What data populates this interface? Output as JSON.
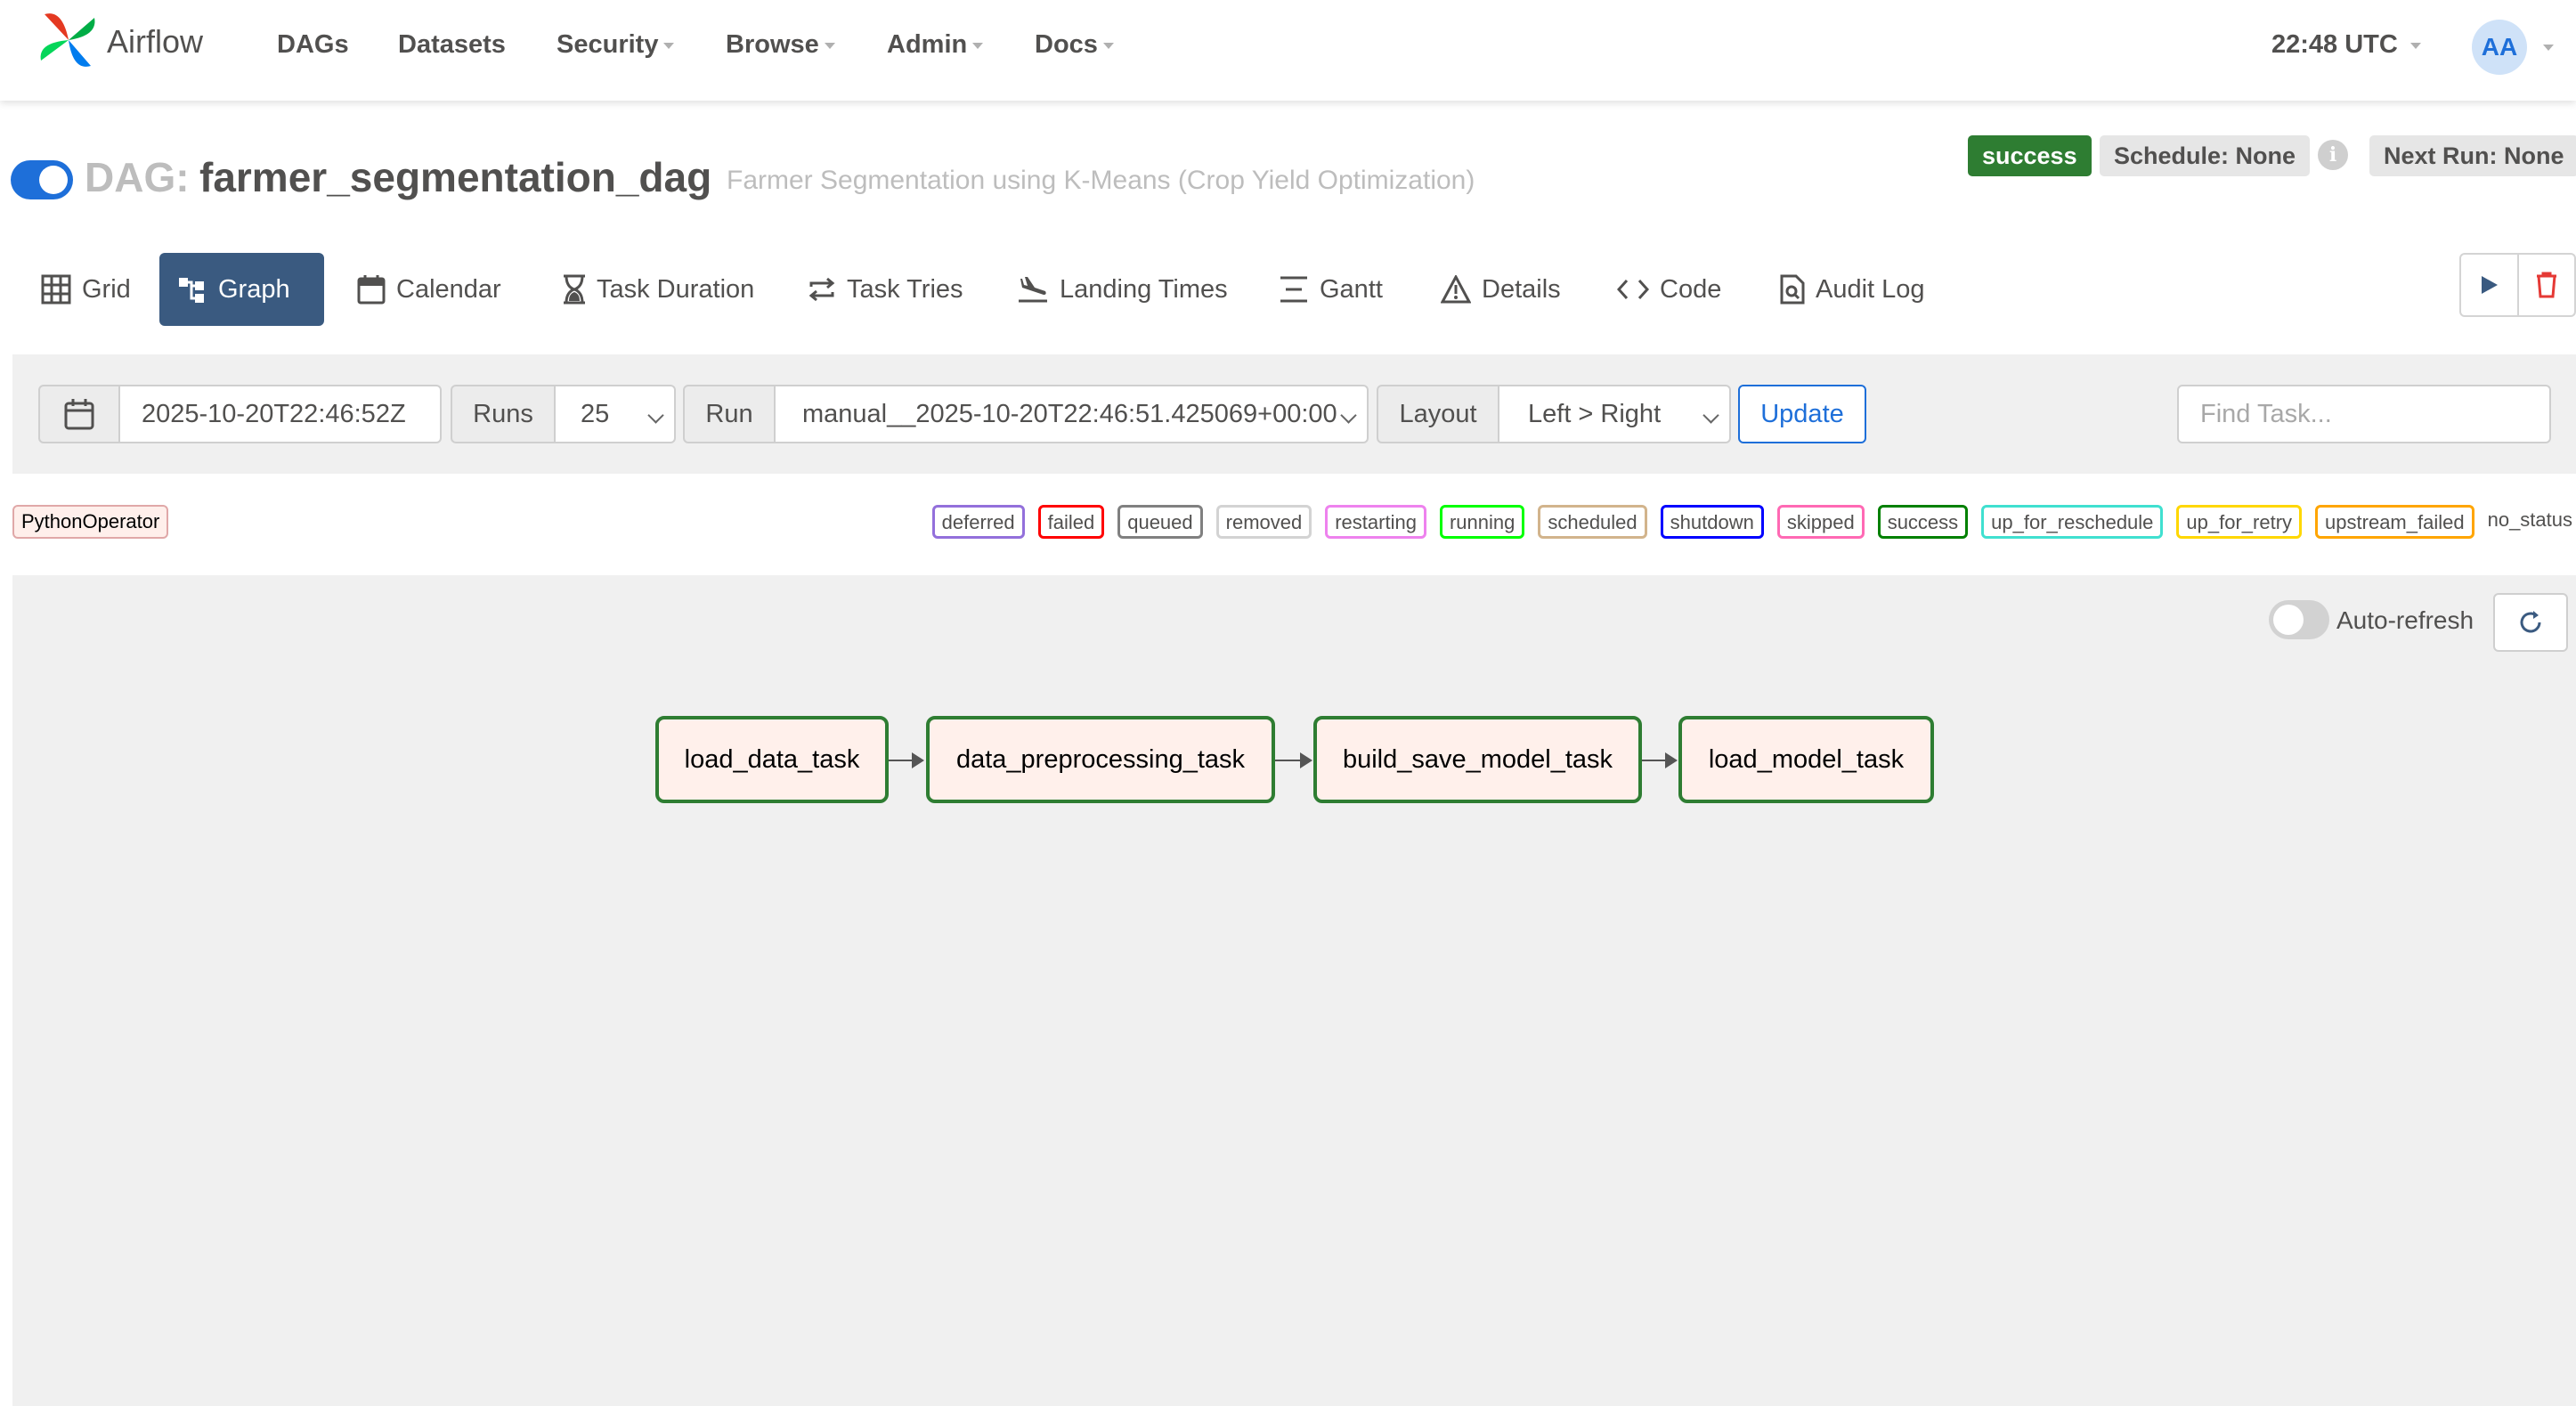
{
  "nav": {
    "logo_text": "Airflow",
    "items": [
      {
        "label": "DAGs"
      },
      {
        "label": "Datasets"
      },
      {
        "label": "Security"
      },
      {
        "label": "Browse"
      },
      {
        "label": "Admin"
      },
      {
        "label": "Docs"
      }
    ],
    "clock": "22:48 UTC",
    "avatar_initials": "AA"
  },
  "dag": {
    "prefix": "DAG:",
    "name": "farmer_segmentation_dag",
    "description": "Farmer Segmentation using K-Means (Crop Yield Optimization)",
    "paused": false,
    "status_badge": "success",
    "schedule": "Schedule: None",
    "next_run": "Next Run: None",
    "info_glyph": "i"
  },
  "tabs": [
    {
      "label": "Grid",
      "icon": "grid-icon",
      "active": false
    },
    {
      "label": "Graph",
      "icon": "graph-icon",
      "active": true
    },
    {
      "label": "Calendar",
      "icon": "calendar-icon",
      "active": false
    },
    {
      "label": "Task Duration",
      "icon": "hourglass-icon",
      "active": false
    },
    {
      "label": "Task Tries",
      "icon": "retry-icon",
      "active": false
    },
    {
      "label": "Landing Times",
      "icon": "landing-icon",
      "active": false
    },
    {
      "label": "Gantt",
      "icon": "gantt-icon",
      "active": false
    },
    {
      "label": "Details",
      "icon": "warning-triangle-icon",
      "active": false
    },
    {
      "label": "Code",
      "icon": "code-icon",
      "active": false
    },
    {
      "label": "Audit Log",
      "icon": "audit-log-icon",
      "active": false
    }
  ],
  "controls": {
    "base_date": "2025-10-20T22:46:52Z",
    "runs_label": "Runs",
    "runs_value": "25",
    "run_label": "Run",
    "run_value": "manual__2025-10-20T22:46:51.425069+00:00",
    "layout_label": "Layout",
    "layout_value": "Left > Right",
    "update_label": "Update",
    "find_placeholder": "Find Task..."
  },
  "operator_chip": "PythonOperator",
  "legend": [
    {
      "label": "deferred",
      "color": "#9370db"
    },
    {
      "label": "failed",
      "color": "#ff0000"
    },
    {
      "label": "queued",
      "color": "#808080"
    },
    {
      "label": "removed",
      "color": "#d3d3d3"
    },
    {
      "label": "restarting",
      "color": "#ee82ee"
    },
    {
      "label": "running",
      "color": "#00ff00"
    },
    {
      "label": "scheduled",
      "color": "#d2b48c"
    },
    {
      "label": "shutdown",
      "color": "#0000ff"
    },
    {
      "label": "skipped",
      "color": "#ff69b4"
    },
    {
      "label": "success",
      "color": "#008000"
    },
    {
      "label": "up_for_reschedule",
      "color": "#40e0d0"
    },
    {
      "label": "up_for_retry",
      "color": "#ffd700"
    },
    {
      "label": "upstream_failed",
      "color": "#ffa500"
    },
    {
      "label": "no_status",
      "color": ""
    }
  ],
  "graph": {
    "auto_refresh_label": "Auto-refresh",
    "auto_refresh_on": false,
    "tasks": [
      {
        "id": "load_data_task",
        "state": "success"
      },
      {
        "id": "data_preprocessing_task",
        "state": "success"
      },
      {
        "id": "build_save_model_task",
        "state": "success"
      },
      {
        "id": "load_model_task",
        "state": "success"
      }
    ]
  },
  "colors": {
    "brand_blue": "#1e6fd9",
    "active_tab": "#3a5a80",
    "success_green": "#2e7d32",
    "node_fill": "#fff0eb"
  }
}
